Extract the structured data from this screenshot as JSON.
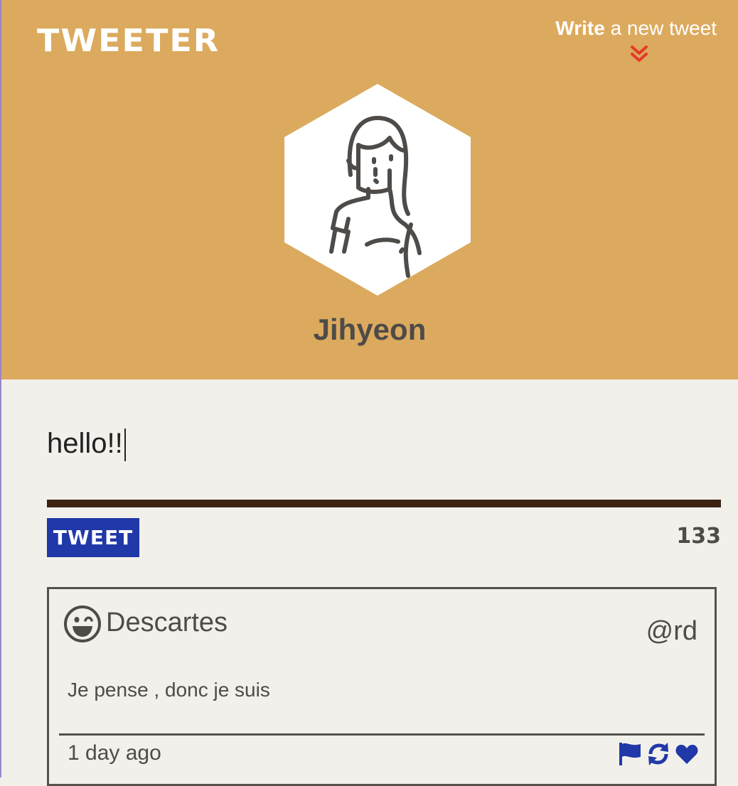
{
  "header": {
    "brand": "TWEETER",
    "compose_bold": "Write",
    "compose_rest": " a new tweet",
    "user_name": "Jihyeon",
    "bg_color": "#dcaa5e"
  },
  "composer": {
    "value": "hello!!",
    "button_label": "TWEET",
    "char_count": "133",
    "button_color": "#2138a8"
  },
  "tweets": [
    {
      "author": "Descartes",
      "handle": "@rd",
      "text": "Je pense , donc je suis",
      "time": "1 day ago",
      "avatar_icon": "wink-emoji-icon",
      "action_icons": [
        "flag-icon",
        "retweet-icon",
        "heart-icon"
      ]
    }
  ]
}
